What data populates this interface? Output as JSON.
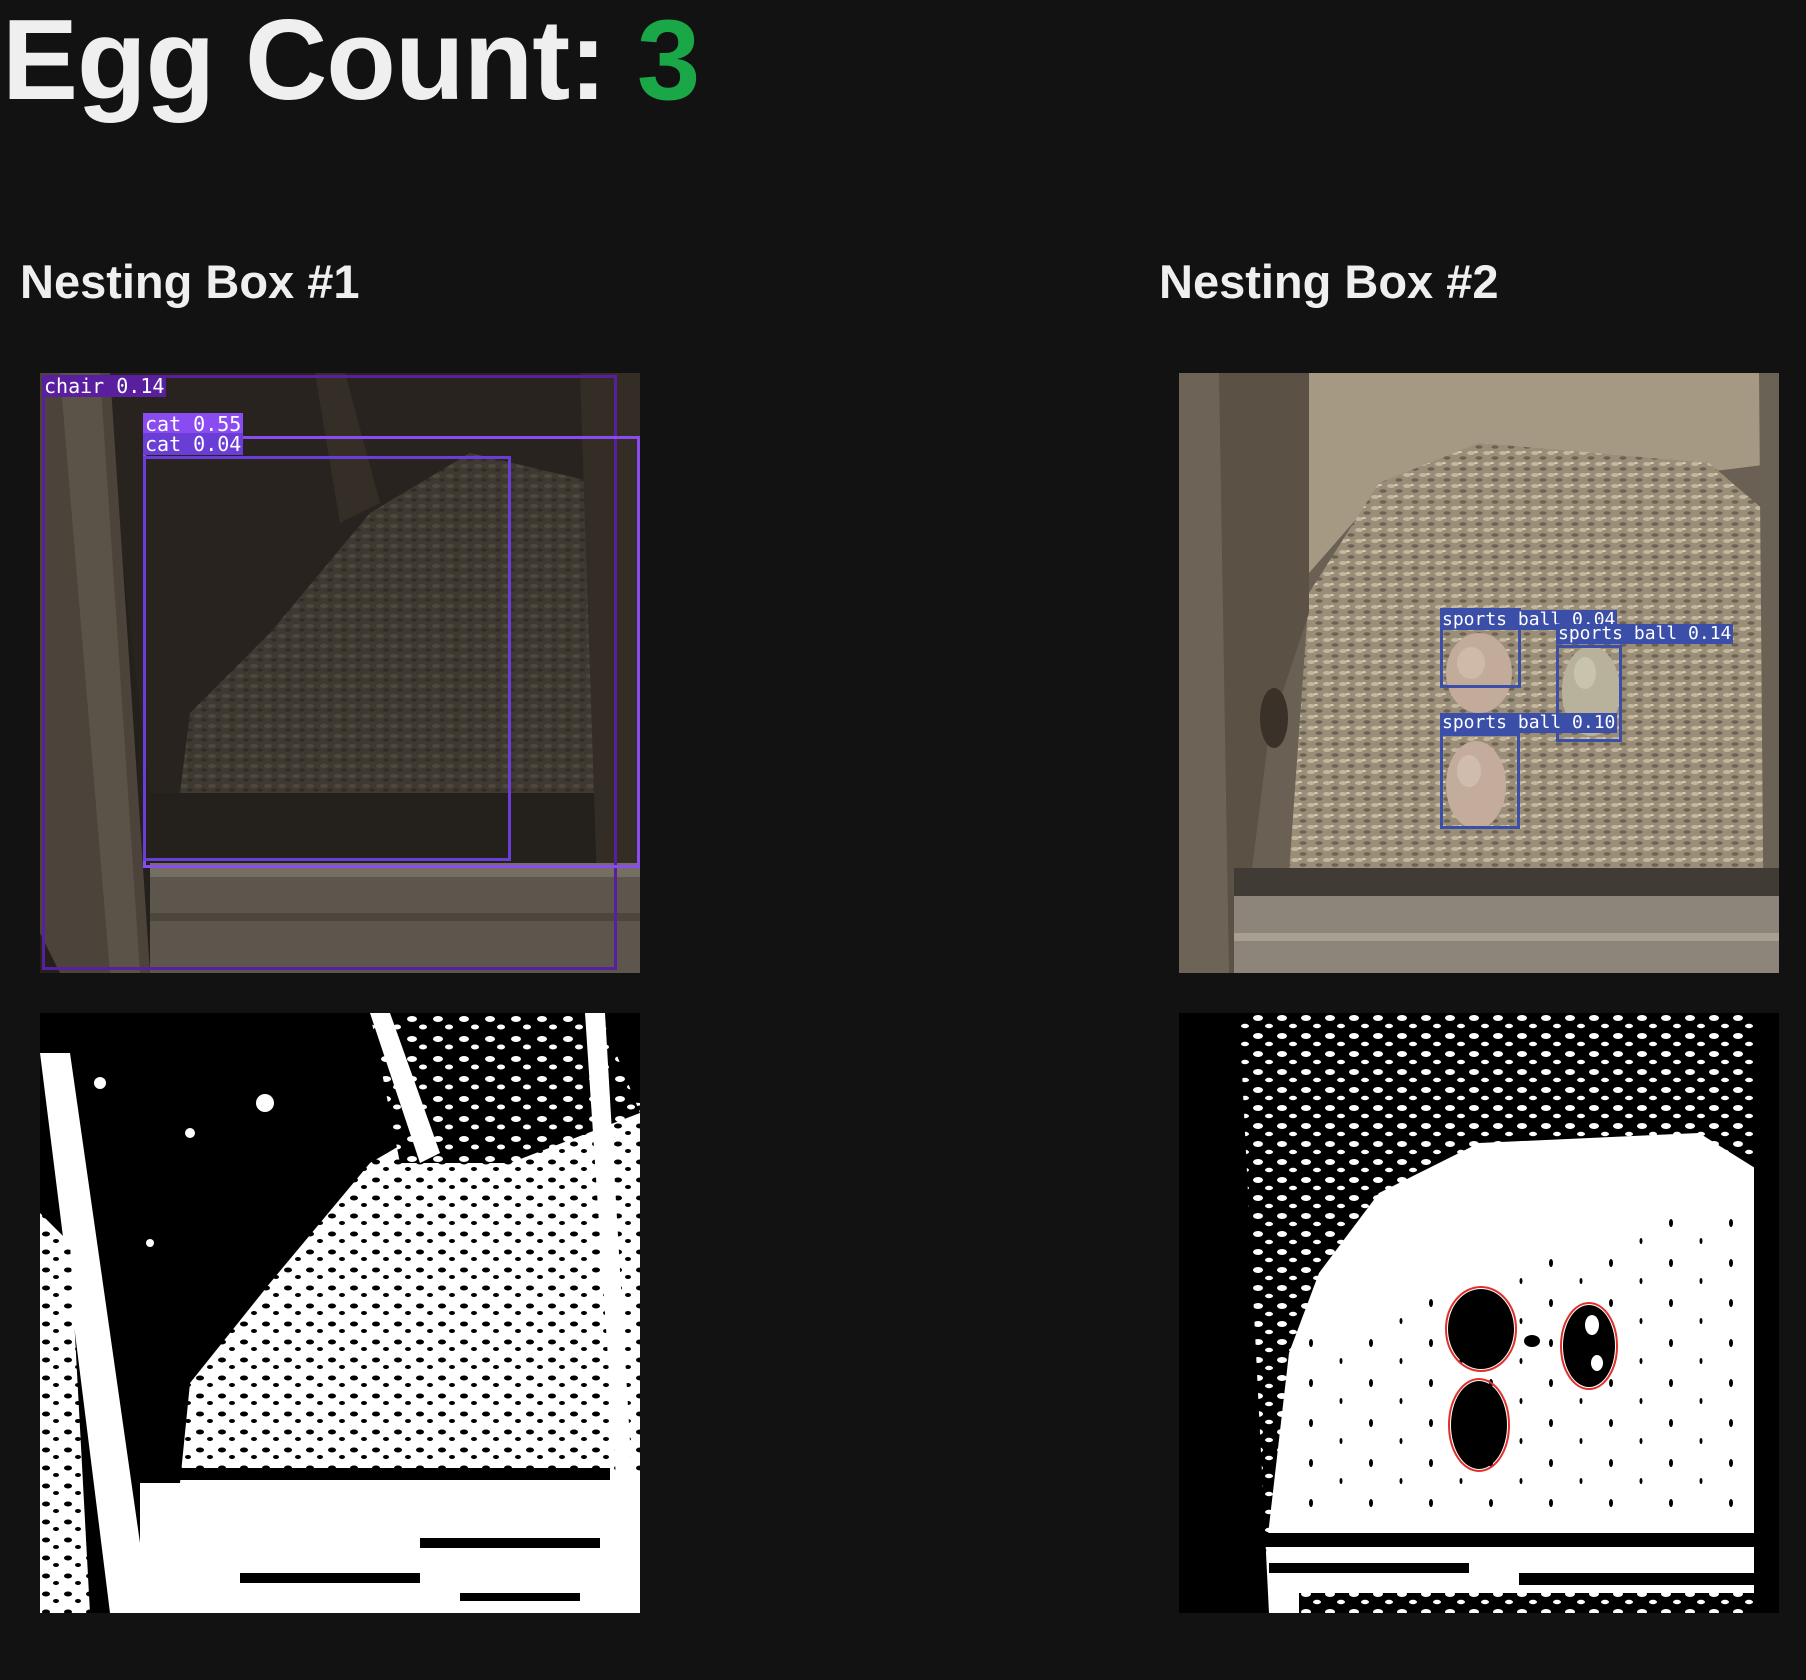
{
  "header": {
    "label": "Egg Count:",
    "count": "3",
    "count_color": "#1aa748"
  },
  "boxes": [
    {
      "title": "Nesting Box #1",
      "camera_image": "camera-feed-dim-nesting-box",
      "threshold_image": "binary-threshold-image",
      "detections": [
        {
          "label": "chair 0.14",
          "color": "#5a1f9e"
        },
        {
          "label": "cat 0.55",
          "color": "#8a4cf0"
        },
        {
          "label": "cat 0.04",
          "color": "#6a3ed6"
        }
      ]
    },
    {
      "title": "Nesting Box #2",
      "camera_image": "camera-feed-nesting-box-with-eggs",
      "threshold_image": "binary-threshold-image-egg-contours",
      "detections": [
        {
          "label": "sports ball 0.04",
          "color": "#3b4ea8"
        },
        {
          "label": "sports ball 0.14",
          "color": "#3b4ea8"
        },
        {
          "label": "sports ball 0.10",
          "color": "#3b4ea8"
        }
      ]
    }
  ]
}
